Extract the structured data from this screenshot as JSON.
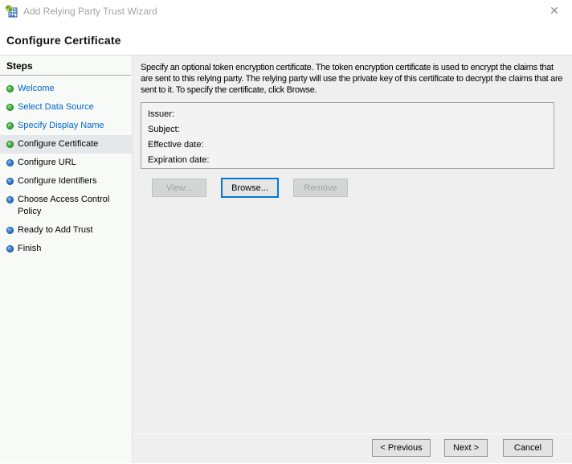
{
  "window": {
    "title": "Add Relying Party Trust Wizard",
    "close_glyph": "✕",
    "app_icon": "adfs-icon"
  },
  "page": {
    "heading": "Configure Certificate"
  },
  "sidebar": {
    "heading": "Steps",
    "items": [
      {
        "label": "Welcome",
        "state": "completed"
      },
      {
        "label": "Select Data Source",
        "state": "completed"
      },
      {
        "label": "Specify Display Name",
        "state": "completed"
      },
      {
        "label": "Configure Certificate",
        "state": "current"
      },
      {
        "label": "Configure URL",
        "state": "upcoming"
      },
      {
        "label": "Configure Identifiers",
        "state": "upcoming"
      },
      {
        "label": "Choose Access Control Policy",
        "state": "upcoming"
      },
      {
        "label": "Ready to Add Trust",
        "state": "upcoming"
      },
      {
        "label": "Finish",
        "state": "upcoming"
      }
    ]
  },
  "main": {
    "description": "Specify an optional token encryption certificate.  The token encryption certificate is used to encrypt the claims that are sent to this relying party.  The relying party will use the private key of this certificate to decrypt the claims that are sent to it.  To specify the certificate, click Browse.",
    "certificate_fields": [
      "Issuer:",
      "Subject:",
      "Effective date:",
      "Expiration date:"
    ],
    "buttons": {
      "view": "View...",
      "browse": "Browse...",
      "remove": "Remove"
    }
  },
  "footer": {
    "previous": "< Previous",
    "next": "Next >",
    "cancel": "Cancel"
  },
  "colors": {
    "accent": "#0078d7",
    "link": "#0066cc",
    "step-done": "#2f9e2f",
    "step-pending": "#2f78cf",
    "sidebar-bg": "#f7faf7",
    "main-bg": "#efefef",
    "highlight-row": "#e4e8eb"
  }
}
